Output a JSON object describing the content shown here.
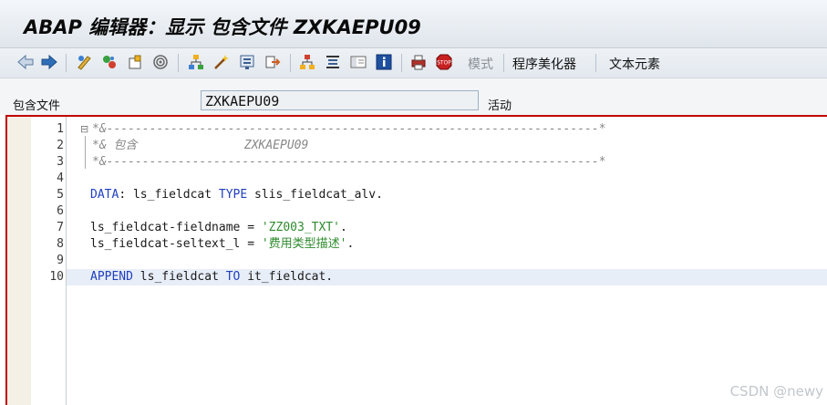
{
  "title": "ABAP 编辑器：显示 包含文件 ZXKAEPU09",
  "toolbar": {
    "icons": [
      "back-arrow-icon",
      "forward-arrow-icon",
      "display-change-icon",
      "object-activate-icon",
      "other-object-icon",
      "where-used-icon",
      "hierarchy-icon",
      "magic-wand-icon",
      "test-icon",
      "export-icon",
      "tree-icon",
      "pretty-print-icon",
      "layout-icon",
      "info-icon",
      "print-icon",
      "stop-breakpoint-icon"
    ],
    "mode_label": "模式",
    "pretty_printer_label": "程序美化器",
    "text_elements_label": "文本元素"
  },
  "field": {
    "label": "包含文件",
    "value": "ZXKAEPU09",
    "status": "活动"
  },
  "code": {
    "line_numbers": [
      "1",
      "2",
      "3",
      "4",
      "5",
      "6",
      "7",
      "8",
      "9",
      "10"
    ],
    "lines": [
      "*&---------------------------------------------------------------------*",
      "*& 包含               ZXKAEPU09",
      "*&---------------------------------------------------------------------*",
      "",
      "DATA: ls_fieldcat TYPE slis_fieldcat_alv.",
      "",
      "ls_fieldcat-fieldname = 'ZZ003_TXT'.",
      "ls_fieldcat-seltext_l = '费用类型描述'.",
      "",
      "APPEND ls_fieldcat TO it_fieldcat."
    ],
    "current_line": 10
  },
  "watermark": "CSDN @newy",
  "colors": {
    "keyword": "#1f3fbf",
    "string": "#2e8b2e",
    "comment": "#888888",
    "editor_border": "#c00000",
    "current_line_bg": "#e8eef8"
  }
}
